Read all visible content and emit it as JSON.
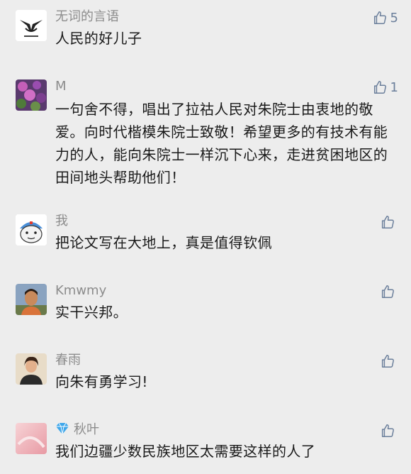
{
  "comments": [
    {
      "name": "无词的言语",
      "text": "人民的好儿子",
      "likes": "5"
    },
    {
      "name": "M",
      "text": "一句舍不得，唱出了拉祜人民对朱院士由衷地的敬爱。向时代楷模朱院士致敬！希望更多的有技术有能力的人，能向朱院士一样沉下心来，走进贫困地区的田间地头帮助他们！",
      "likes": "1"
    },
    {
      "name": "我",
      "text": "把论文写在大地上，真是值得钦佩",
      "likes": ""
    },
    {
      "name": "Kmwmy",
      "text": "实干兴邦。",
      "likes": ""
    },
    {
      "name": "春雨",
      "text": "向朱有勇学习!",
      "likes": ""
    },
    {
      "name": "秋叶",
      "text": "我们边疆少数民族地区太需要这样的人了",
      "likes": ""
    }
  ],
  "colors": {
    "background": "#ededed",
    "name": "#8c8c8c",
    "text": "#1a1a1a",
    "like": "#6b7f9b"
  }
}
